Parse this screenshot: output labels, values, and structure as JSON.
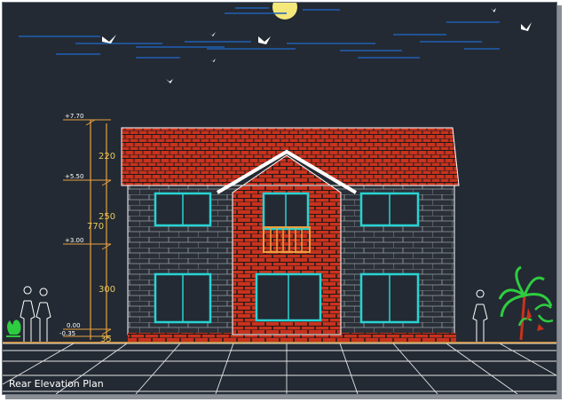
{
  "caption": "Rear Elevation Plan",
  "levels": {
    "top": "+7.70",
    "second": "+5.50",
    "first": "+3.00",
    "ground": "0.00",
    "plinth": "-0.35"
  },
  "dimensions": {
    "roof": "220",
    "upper_floor": "250",
    "total": "770",
    "ground_floor": "300",
    "plinth": "35"
  },
  "colors": {
    "background": "#232a33",
    "brick": "#c8321e",
    "mortar": "#1a1a1a",
    "window_frame": "#29d3d3",
    "dimension_line": "#e8a040",
    "grid": "#e6e6e6",
    "moon": "#f5e87a"
  },
  "icons": [
    "moon-icon",
    "bird-icon",
    "person-silhouette-icon",
    "palm-tree-icon",
    "shrub-icon"
  ]
}
